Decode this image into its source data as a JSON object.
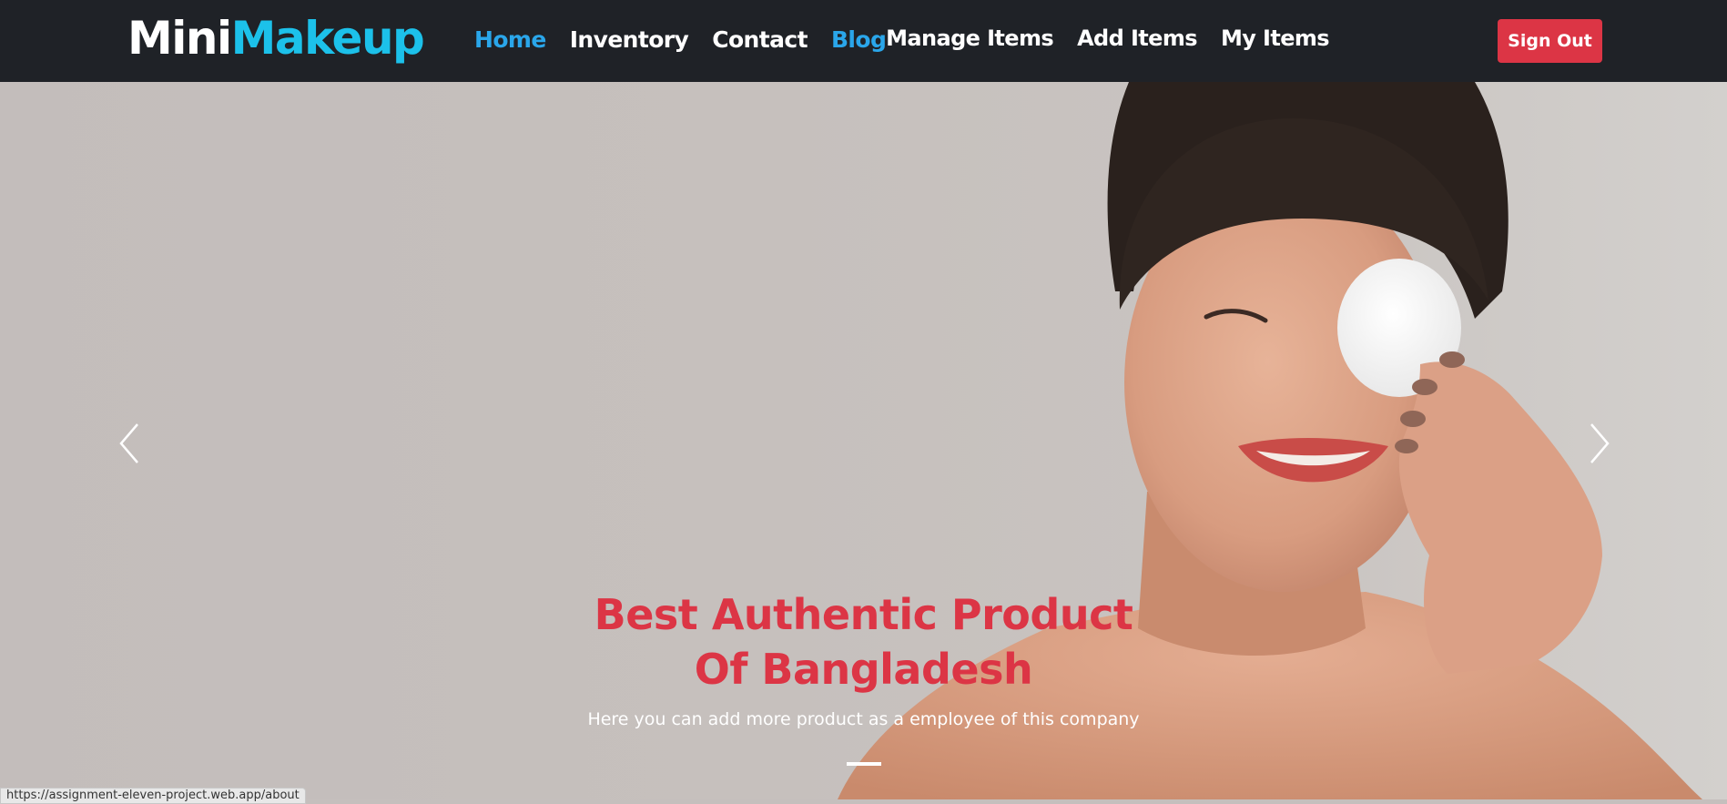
{
  "brand": {
    "part1": "Mini",
    "part2": "Makeup",
    "color_primary": "#ffffff",
    "color_accent": "#1cc1ea"
  },
  "nav": {
    "left": [
      {
        "label": "Home",
        "active": true
      },
      {
        "label": "Inventory",
        "active": false
      },
      {
        "label": "Contact",
        "active": false
      },
      {
        "label": "Blog",
        "active": true
      }
    ],
    "right": [
      {
        "label": "Manage Items"
      },
      {
        "label": "Add Items"
      },
      {
        "label": "My Items"
      }
    ],
    "signout_label": "Sign Out"
  },
  "hero": {
    "headline_line1": "Best Authentic Product",
    "headline_line2": "Of Bangladesh",
    "subtext": "Here you can add more product as a employee of this company",
    "prev_icon": "chevron-left-icon",
    "next_icon": "chevron-right-icon",
    "slide_count": 1,
    "active_slide": 1
  },
  "status_url": "https://assignment-eleven-project.web.app/about",
  "colors": {
    "navbar_bg": "#1f2227",
    "link_active": "#2aa6ea",
    "signout_bg": "#dc3545",
    "headline": "#dc3545"
  }
}
